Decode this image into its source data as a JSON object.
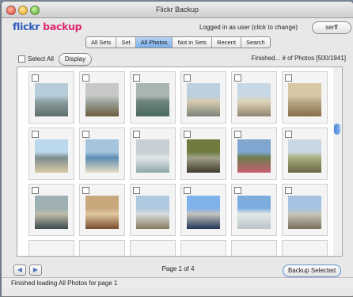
{
  "window": {
    "title": "Flickr Backup"
  },
  "header": {
    "logo_part1": "flickr",
    "logo_part2": "backup",
    "login_text": "Logged in as user (click to change)",
    "user_button": "serff"
  },
  "tabs": [
    {
      "label": "All Sets",
      "active": false
    },
    {
      "label": "Set",
      "active": false
    },
    {
      "label": "All Photos",
      "active": true
    },
    {
      "label": "Not in Sets",
      "active": false
    },
    {
      "label": "Recent",
      "active": false
    },
    {
      "label": "Search",
      "active": false
    }
  ],
  "toolbar": {
    "select_all": "Select All",
    "display_button": "Display",
    "status": "Finished... # of Photos [500/1941]"
  },
  "photos": [
    {
      "scene": "pier-coast",
      "colors": [
        "#b7ccd9",
        "#5f6e6c",
        "#8e9fa0"
      ]
    },
    {
      "scene": "plant-closeup",
      "colors": [
        "#c6c9c7",
        "#6e5c3e",
        "#9ba69e"
      ]
    },
    {
      "scene": "succulents",
      "colors": [
        "#a9b5b2",
        "#4c6a5f",
        "#6f847b"
      ]
    },
    {
      "scene": "beach-cove",
      "colors": [
        "#bcd0e0",
        "#7b8378",
        "#d7cbb0"
      ]
    },
    {
      "scene": "beach-rocks",
      "colors": [
        "#c7d7e4",
        "#8e8470",
        "#e0d3b6"
      ]
    },
    {
      "scene": "carved-wood",
      "colors": [
        "#d7c8a5",
        "#8b6d48",
        "#b8a98a"
      ]
    },
    {
      "scene": "beach-palms",
      "colors": [
        "#bcd8ec",
        "#d9c9a4",
        "#7c8e8d"
      ]
    },
    {
      "scene": "beach-wave",
      "colors": [
        "#a6c4dc",
        "#e6dcc2",
        "#5a8db2"
      ]
    },
    {
      "scene": "shoreline",
      "colors": [
        "#c5cfd4",
        "#8fa6aa",
        "#dfe6e6"
      ]
    },
    {
      "scene": "tree-trunk",
      "colors": [
        "#6f7b3f",
        "#3f3a2e",
        "#a3a28b"
      ]
    },
    {
      "scene": "protea-flower",
      "colors": [
        "#7fa6cf",
        "#c65f73",
        "#6d7c4c"
      ]
    },
    {
      "scene": "rocky-hills",
      "colors": [
        "#c9d7e2",
        "#6b6547",
        "#a6b07d"
      ]
    },
    {
      "scene": "walkway-bridge",
      "colors": [
        "#9eb0b3",
        "#3d4a4f",
        "#bdbca8"
      ]
    },
    {
      "scene": "spiral-stairs",
      "colors": [
        "#c9a77c",
        "#7b4d2c",
        "#e1c7a0"
      ]
    },
    {
      "scene": "cliff-view",
      "colors": [
        "#b0c8e0",
        "#867b62",
        "#d8dcdc"
      ]
    },
    {
      "scene": "person-outdoors",
      "colors": [
        "#7fb1ea",
        "#223455",
        "#c3c4c0"
      ]
    },
    {
      "scene": "city-bay",
      "colors": [
        "#7dadde",
        "#b9c4ca",
        "#e4e7e7"
      ]
    },
    {
      "scene": "coast-town",
      "colors": [
        "#a5c2e3",
        "#7b6f5d",
        "#c7c6b7"
      ]
    }
  ],
  "pager": {
    "prev_icon": "left-arrow",
    "next_icon": "right-arrow",
    "page_label": "Page 1 of 4"
  },
  "actions": {
    "backup_button": "Backup Selected"
  },
  "statusbar": {
    "text": "Finished loading All Photos for page 1"
  }
}
